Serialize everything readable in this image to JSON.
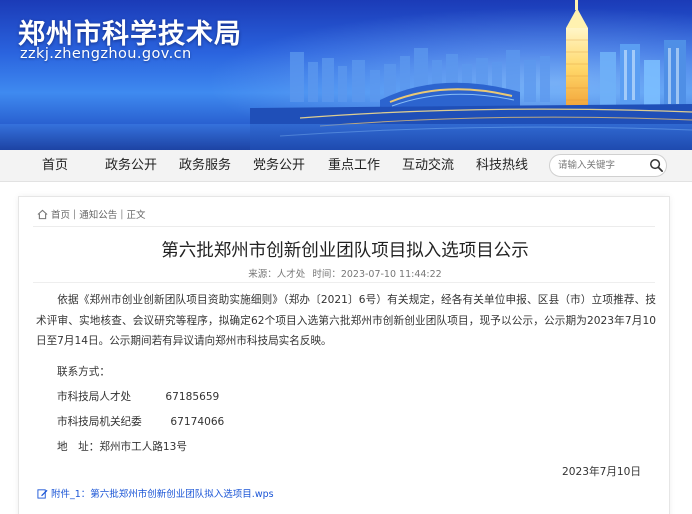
{
  "header": {
    "site_title": "郑州市科学技术局",
    "site_domain": "zzkj.zhengzhou.gov.cn"
  },
  "nav": {
    "items": [
      "首页",
      "政务公开",
      "政务服务",
      "党务公开",
      "重点工作",
      "互动交流",
      "科技热线"
    ],
    "search_placeholder": "请输入关键字"
  },
  "breadcrumb": {
    "home": "首页",
    "section": "通知公告",
    "current": "正文"
  },
  "article": {
    "title": "第六批郑州市创新创业团队项目拟入选项目公示",
    "meta_source": "来源：人才处",
    "meta_time": "时间：2023-07-10 11:44:22",
    "paragraph": "依据《郑州市创业创新团队项目资助实施细则》（郑办〔2021〕6号）有关规定，经各有关单位申报、区县（市）立项推荐、技术评审、实地核查、会议研究等程序，拟确定62个项目入选第六批郑州市创新创业团队项目，现予以公示，公示期为2023年7月10日至7月14日。公示期间若有异议请向郑州市科技局实名反映。",
    "contact_heading": "联系方式：",
    "contacts": [
      {
        "label": "市科技局人才处",
        "value": "67185659"
      },
      {
        "label": "市科技局机关纪委",
        "value": "67174066"
      }
    ],
    "address": "地　址：郑州市工人路13号",
    "date": "2023年7月10日",
    "attachment": "附件_1：第六批郑州市创新创业团队拟入选项目.wps"
  },
  "colors": {
    "banner_blue": "#2a63de",
    "link_blue": "#1a55d6",
    "nav_bg": "#f3f3f3"
  }
}
